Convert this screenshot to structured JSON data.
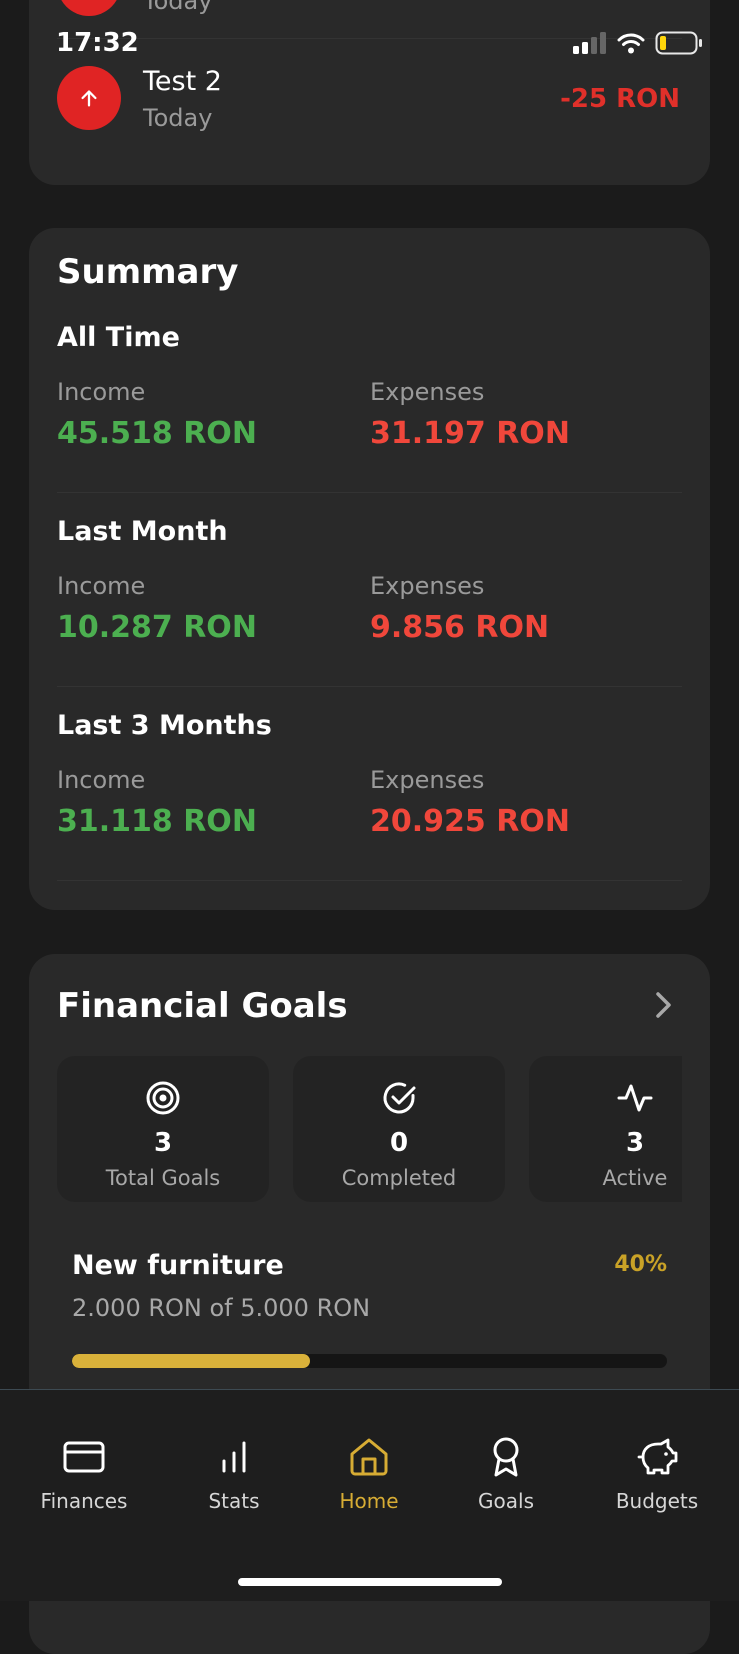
{
  "status_bar": {
    "time": "17:32"
  },
  "transactions": {
    "partial_item": {
      "date": "Today"
    },
    "items": [
      {
        "title": "Test 2",
        "date": "Today",
        "amount": "-25 RON"
      }
    ]
  },
  "summary": {
    "title": "Summary",
    "periods": [
      {
        "label": "All Time",
        "income_label": "Income",
        "income": "45.518 RON",
        "expenses_label": "Expenses",
        "expenses": "31.197 RON"
      },
      {
        "label": "Last Month",
        "income_label": "Income",
        "income": "10.287 RON",
        "expenses_label": "Expenses",
        "expenses": "9.856 RON"
      },
      {
        "label": "Last 3 Months",
        "income_label": "Income",
        "income": "31.118 RON",
        "expenses_label": "Expenses",
        "expenses": "20.925 RON"
      }
    ]
  },
  "goals": {
    "title": "Financial Goals",
    "stats": [
      {
        "icon": "target-icon",
        "value": "3",
        "label": "Total Goals"
      },
      {
        "icon": "check-circle-icon",
        "value": "0",
        "label": "Completed"
      },
      {
        "icon": "activity-icon",
        "value": "3",
        "label": "Active"
      }
    ],
    "items": [
      {
        "name": "New furniture",
        "percent": "40%",
        "progress": "2.000 RON of 5.000 RON",
        "fraction": 0.4
      }
    ]
  },
  "tabbar": {
    "tabs": [
      {
        "label": "Finances",
        "icon": "card-icon"
      },
      {
        "label": "Stats",
        "icon": "bar-chart-icon"
      },
      {
        "label": "Home",
        "icon": "home-icon",
        "active": true
      },
      {
        "label": "Goals",
        "icon": "award-icon"
      },
      {
        "label": "Budgets",
        "icon": "piggy-bank-icon"
      }
    ]
  },
  "colors": {
    "accent": "#d7ac34",
    "income": "#4caf50",
    "expense": "#f0473b",
    "card": "#292929",
    "background": "#1b1b1b"
  }
}
